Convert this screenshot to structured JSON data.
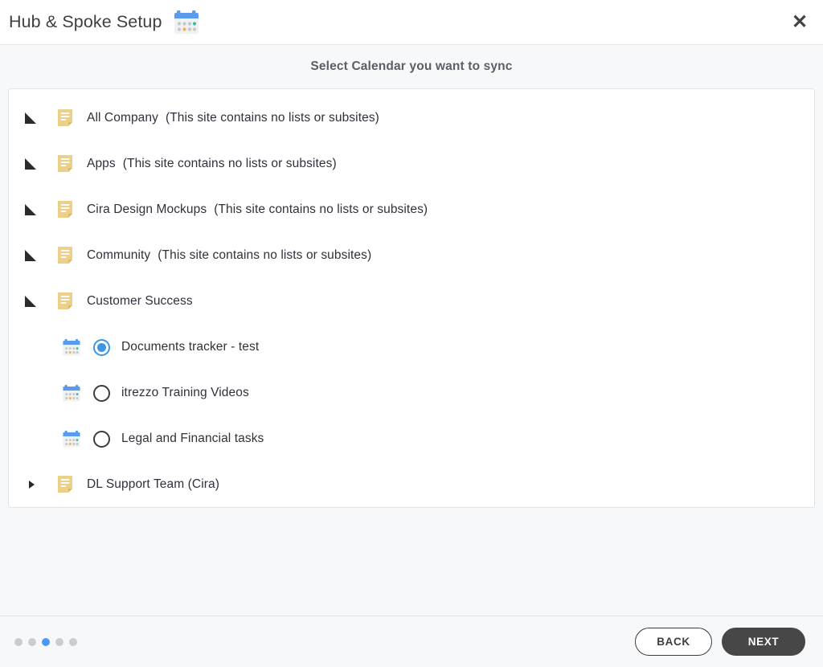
{
  "header": {
    "title": "Hub & Spoke Setup",
    "icon": "calendar-icon",
    "close_label": "✕"
  },
  "subtitle": "Select Calendar you want to sync",
  "tree": {
    "rows": [
      {
        "twisty": "expanded",
        "icon": "site-document-icon",
        "label": "All Company",
        "note": "(This site contains no lists or subsites)",
        "type": "site",
        "indent": 0
      },
      {
        "twisty": "expanded",
        "icon": "site-document-icon",
        "label": "Apps",
        "note": "(This site contains no lists or subsites)",
        "type": "site",
        "indent": 0
      },
      {
        "twisty": "expanded",
        "icon": "site-document-icon",
        "label": "Cira Design Mockups",
        "note": "(This site contains no lists or subsites)",
        "type": "site",
        "indent": 0
      },
      {
        "twisty": "expanded",
        "icon": "site-document-icon",
        "label": "Community",
        "note": "(This site contains no lists or subsites)",
        "type": "site",
        "indent": 0
      },
      {
        "twisty": "expanded",
        "icon": "site-document-icon",
        "label": "Customer Success",
        "note": "",
        "type": "site",
        "indent": 0
      },
      {
        "twisty": "none",
        "icon": "calendar-icon",
        "label": "Documents tracker - test",
        "note": "",
        "type": "calendar",
        "indent": 1,
        "selected": true
      },
      {
        "twisty": "none",
        "icon": "calendar-icon",
        "label": "itrezzo Training Videos",
        "note": "",
        "type": "calendar",
        "indent": 1,
        "selected": false
      },
      {
        "twisty": "none",
        "icon": "calendar-icon",
        "label": "Legal and Financial tasks",
        "note": "",
        "type": "calendar",
        "indent": 1,
        "selected": false
      },
      {
        "twisty": "collapsed",
        "icon": "site-document-icon",
        "label": "DL Support Team (Cira)",
        "note": "",
        "type": "site",
        "indent": 0
      }
    ]
  },
  "footer": {
    "dots": {
      "count": 5,
      "active_index": 2
    },
    "back_label": "BACK",
    "next_label": "NEXT"
  },
  "colors": {
    "accent_blue": "#3b95e8",
    "dot_active": "#4a9bf0",
    "next_button": "#474747",
    "site_icon": "#edce84",
    "page_bg": "#f7f8fa"
  }
}
